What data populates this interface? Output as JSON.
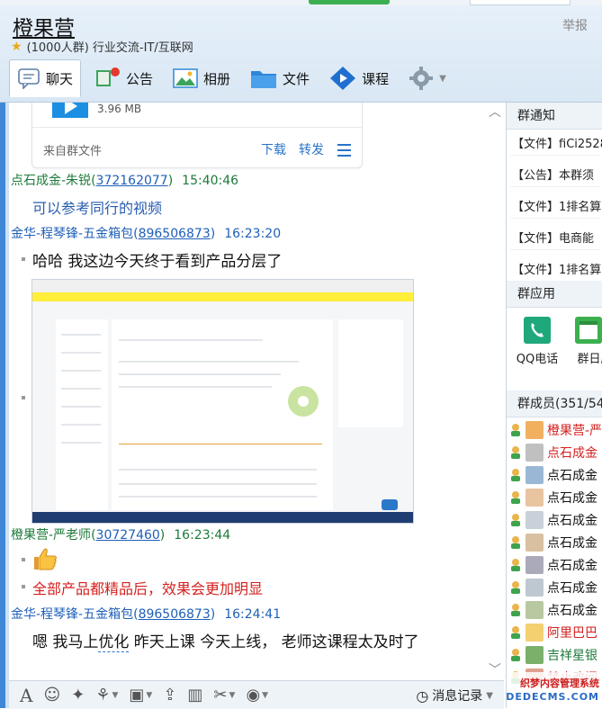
{
  "window": {
    "title": "橙果营",
    "report_label": "举报",
    "group_info": "(1000人群) 行业交流-IT/互联网"
  },
  "toolbar": {
    "items": [
      "聊天",
      "公告",
      "相册",
      "文件",
      "课程"
    ]
  },
  "file_card": {
    "size": "3.96 MB",
    "source": "来自群文件",
    "download": "下载",
    "forward": "转发"
  },
  "messages": [
    {
      "name": "点石成金-朱锐",
      "qq": "372162077",
      "time": "15:40:46",
      "text": "可以参考同行的视频"
    },
    {
      "name": "金华-程琴锋-五金箱包",
      "qq": "896506873",
      "time": "16:23:20",
      "text": "哈哈 我这边今天终于看到产品分层了"
    },
    {
      "name": "橙果营-严老师",
      "qq": "30727460",
      "time": "16:23:44",
      "text": "全部产品都精品后，效果会更加明显"
    },
    {
      "name": "金华-程琴锋-五金箱包",
      "qq": "896506873",
      "time": "16:24:41",
      "text_before": "嗯 我马上",
      "text_underlined": "优化",
      "text_after": " 昨天上课 今天上线，  老师这课程太及时了"
    }
  ],
  "input_toolbar": {
    "history": "消息记录"
  },
  "right_panel": {
    "notice_header": "群通知",
    "notices": [
      "【文件】fiCi2528",
      "【公告】本群须",
      "【文件】1排名算",
      "【文件】电商能",
      "【文件】1排名算"
    ],
    "apps_header": "群应用",
    "apps": [
      "QQ电话",
      "群日历"
    ],
    "members_header": "群成员(351/54",
    "members": [
      {
        "name": "橙果营-严",
        "style": "red"
      },
      {
        "name": "点石成金",
        "style": "red"
      },
      {
        "name": "点石成金",
        "style": "normal"
      },
      {
        "name": "点石成金",
        "style": "normal"
      },
      {
        "name": "点石成金",
        "style": "normal"
      },
      {
        "name": "点石成金",
        "style": "normal"
      },
      {
        "name": "点石成金",
        "style": "normal"
      },
      {
        "name": "点石成金",
        "style": "normal"
      },
      {
        "name": "点石成金",
        "style": "normal"
      },
      {
        "name": "阿里巴巴",
        "style": "red"
      },
      {
        "name": "吉祥星银",
        "style": "green"
      },
      {
        "name": "禁止改间",
        "style": "red"
      }
    ]
  },
  "watermark": {
    "line1": "织梦内容管理系统",
    "line2": "DEDECMS.COM"
  },
  "colors": {
    "header_bg": "#dde9f5",
    "accent_blue": "#2a74c8",
    "sender_green": "#1d7a3a",
    "alert_red": "#d61f1f"
  }
}
